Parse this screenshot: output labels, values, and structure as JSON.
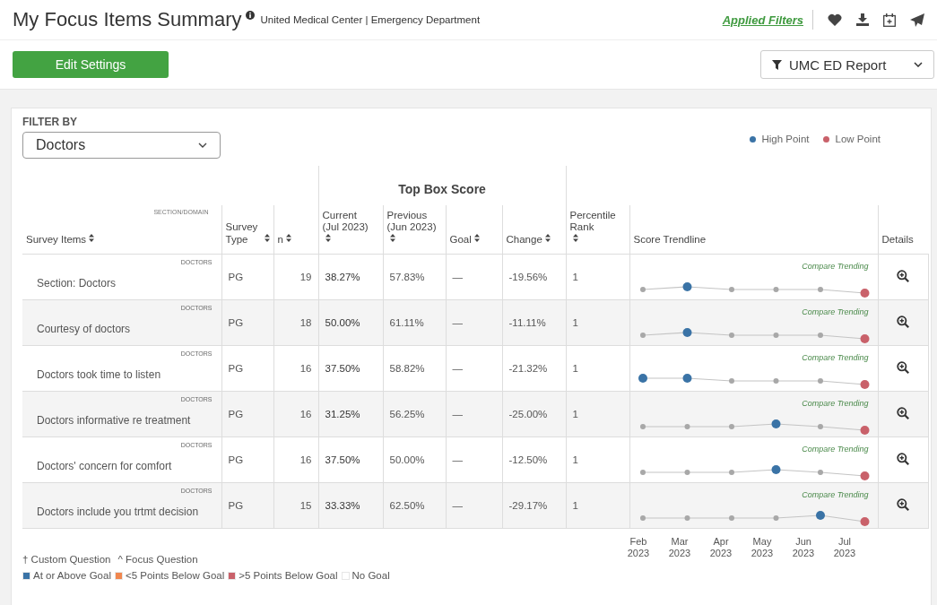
{
  "header": {
    "title": "My Focus Items Summary",
    "subtitle": "United Medical Center | Emergency Department",
    "applied_filters": "Applied Filters"
  },
  "toolbar": {
    "edit_button": "Edit Settings",
    "report_menu": "UMC ED Report"
  },
  "filter": {
    "label": "FILTER BY",
    "value": "Doctors"
  },
  "point_legend": [
    {
      "label": "High Point",
      "color": "#3a73a6"
    },
    {
      "label": "Low Point",
      "color": "#c9616a"
    }
  ],
  "table": {
    "group_header": "Top Box Score",
    "section_domain_label": "SECTION/DOMAIN",
    "columns": [
      {
        "label": "Survey Items",
        "sortable": true
      },
      {
        "label": "Survey Type",
        "sortable": true
      },
      {
        "label": "n",
        "sortable": true
      },
      {
        "label": "Current (Jul 2023)",
        "sortable": true
      },
      {
        "label": "Previous (Jun 2023)",
        "sortable": true
      },
      {
        "label": "Goal",
        "sortable": true
      },
      {
        "label": "Change",
        "sortable": true
      },
      {
        "label": "Percentile Rank",
        "sortable": true
      },
      {
        "label": "Score Trendline",
        "sortable": false
      },
      {
        "label": "Details",
        "sortable": false
      }
    ],
    "rows": [
      {
        "domain": "DOCTORS",
        "item": "Section: Doctors",
        "survey_type": "PG",
        "n": "19",
        "current": "38.27%",
        "previous": "57.83%",
        "goal": "—",
        "change": "-19.56%",
        "percentile_rank": "1",
        "compare_link": "Compare Trending",
        "trend": [
          {
            "kind": "normal"
          },
          {
            "kind": "high"
          },
          {
            "kind": "normal"
          },
          {
            "kind": "normal"
          },
          {
            "kind": "normal"
          },
          {
            "kind": "low"
          }
        ]
      },
      {
        "domain": "DOCTORS",
        "item": "Courtesy of doctors",
        "survey_type": "PG",
        "n": "18",
        "current": "50.00%",
        "previous": "61.11%",
        "goal": "—",
        "change": "-11.11%",
        "percentile_rank": "1",
        "compare_link": "Compare Trending",
        "trend": [
          {
            "kind": "normal"
          },
          {
            "kind": "high"
          },
          {
            "kind": "normal"
          },
          {
            "kind": "normal"
          },
          {
            "kind": "normal"
          },
          {
            "kind": "low"
          }
        ]
      },
      {
        "domain": "DOCTORS",
        "item": "Doctors took time to listen",
        "survey_type": "PG",
        "n": "16",
        "current": "37.50%",
        "previous": "58.82%",
        "goal": "—",
        "change": "-21.32%",
        "percentile_rank": "1",
        "compare_link": "Compare Trending",
        "trend": [
          {
            "kind": "high"
          },
          {
            "kind": "high"
          },
          {
            "kind": "normal"
          },
          {
            "kind": "normal"
          },
          {
            "kind": "normal"
          },
          {
            "kind": "low"
          }
        ]
      },
      {
        "domain": "DOCTORS",
        "item": "Doctors informative re treatment",
        "survey_type": "PG",
        "n": "16",
        "current": "31.25%",
        "previous": "56.25%",
        "goal": "—",
        "change": "-25.00%",
        "percentile_rank": "1",
        "compare_link": "Compare Trending",
        "trend": [
          {
            "kind": "normal"
          },
          {
            "kind": "normal"
          },
          {
            "kind": "normal"
          },
          {
            "kind": "high"
          },
          {
            "kind": "normal"
          },
          {
            "kind": "low"
          }
        ]
      },
      {
        "domain": "DOCTORS",
        "item": "Doctors' concern for comfort",
        "survey_type": "PG",
        "n": "16",
        "current": "37.50%",
        "previous": "50.00%",
        "goal": "—",
        "change": "-12.50%",
        "percentile_rank": "1",
        "compare_link": "Compare Trending",
        "trend": [
          {
            "kind": "normal"
          },
          {
            "kind": "normal"
          },
          {
            "kind": "normal"
          },
          {
            "kind": "high"
          },
          {
            "kind": "normal"
          },
          {
            "kind": "low"
          }
        ]
      },
      {
        "domain": "DOCTORS",
        "item": "Doctors include you trtmt decision",
        "survey_type": "PG",
        "n": "15",
        "current": "33.33%",
        "previous": "62.50%",
        "goal": "—",
        "change": "-29.17%",
        "percentile_rank": "1",
        "compare_link": "Compare Trending",
        "trend": [
          {
            "kind": "normal"
          },
          {
            "kind": "normal"
          },
          {
            "kind": "normal"
          },
          {
            "kind": "normal"
          },
          {
            "kind": "high"
          },
          {
            "kind": "low"
          }
        ]
      }
    ]
  },
  "months": [
    {
      "month": "Feb",
      "year": "2023"
    },
    {
      "month": "Mar",
      "year": "2023"
    },
    {
      "month": "Apr",
      "year": "2023"
    },
    {
      "month": "May",
      "year": "2023"
    },
    {
      "month": "Jun",
      "year": "2023"
    },
    {
      "month": "Jul",
      "year": "2023"
    }
  ],
  "footnotes": [
    "† Custom Question",
    "^ Focus Question"
  ],
  "goal_legend": [
    {
      "label": "At or Above Goal",
      "color": "#3a73a6"
    },
    {
      "label": "<5 Points Below Goal",
      "color": "#f0874f"
    },
    {
      "label": ">5 Points Below Goal",
      "color": "#c9616a"
    },
    {
      "label": "No Goal",
      "color": "#ffffff"
    }
  ]
}
